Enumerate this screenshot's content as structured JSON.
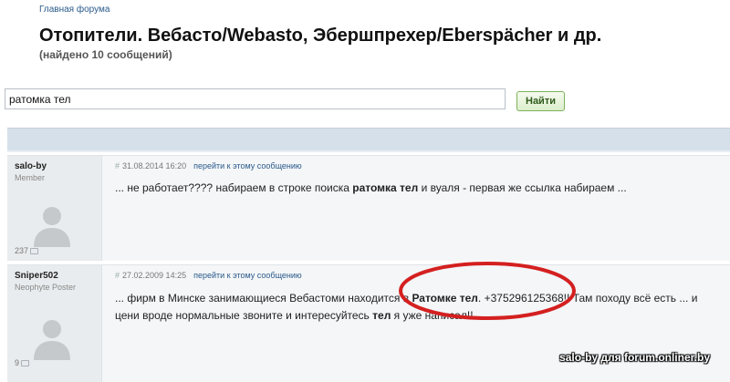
{
  "breadcrumb": "Главная форума",
  "page_title": "Отопители. Вебасто/Webasto, Эбершпрехер/Eberspächer и др.",
  "subtitle": "(найдено 10 сообщений)",
  "search": {
    "value": "ратомка тел",
    "button_label": "Найти"
  },
  "posts": [
    {
      "author": "salo-by",
      "role": "Member",
      "post_count": "237",
      "hash": "#",
      "date": "31.08.2014 16:20",
      "goto_label": "перейти к этому сообщению",
      "body_parts": [
        "... не работает???? набираем в строке поиска ",
        "ратомка тел",
        " и вуаля - первая же ссылка набираем ..."
      ]
    },
    {
      "author": "Sniper502",
      "role": "Neophyte Poster",
      "post_count": "9",
      "hash": "#",
      "date": "27.02.2009 14:25",
      "goto_label": "перейти к этому сообщению",
      "line1_parts": [
        "... фирм в Минске занимающиеся Вебастоми находится в ",
        "Ратомке тел",
        ". +375296125368!! Там походу всё есть ... и"
      ],
      "line2_parts": [
        "цени вроде нормальные звоните и интересуйтесь ",
        "тел",
        " я уже написал!!"
      ]
    }
  ],
  "annotation": {
    "color": "#d42020"
  },
  "watermark": "salo-by для forum.onliner.by",
  "icons": {
    "avatar": "user-silhouette-icon",
    "posts": "message-icon"
  }
}
